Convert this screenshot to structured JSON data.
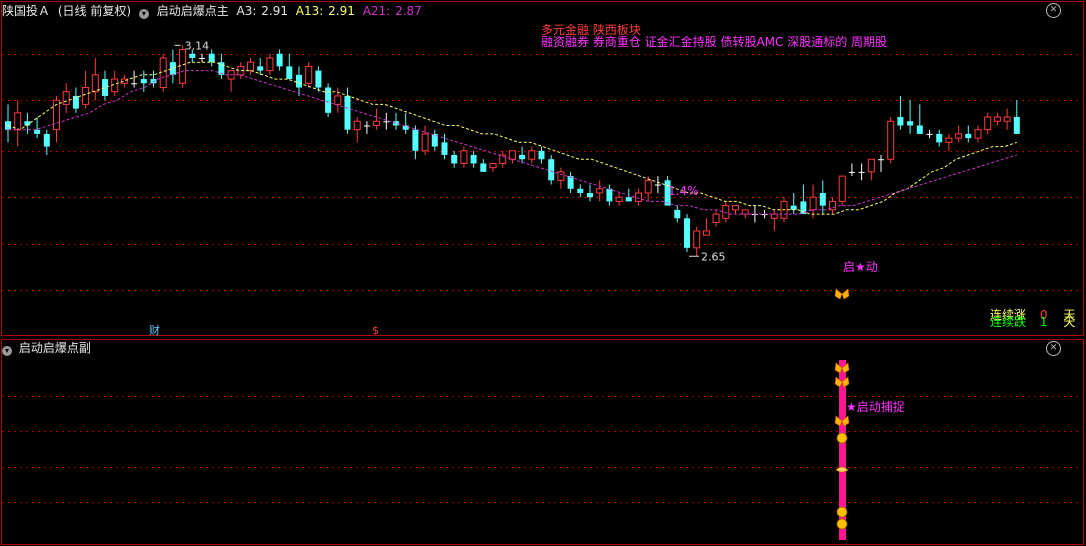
{
  "header": {
    "symbol": "陕国投Ａ",
    "period": "(日线 前复权)",
    "main_indicator": "启动启爆点主",
    "a3_label": "A3:",
    "a3_value": "2.91",
    "a13_label": "A13:",
    "a13_value": "2.91",
    "a21_label": "A21:",
    "a21_value": "2.87"
  },
  "sub_panel": {
    "indicator": "启动启爆点副",
    "annotation": "★启动捕捉"
  },
  "concept_text": {
    "line1": "多元金融 陕西板块",
    "line2": "融资融券 券商重仓 证金汇金持股 债转股AMC 深股通标的 周期股"
  },
  "annotations": {
    "high_label": "3.14",
    "low_label": "2.65",
    "pct_label": "1.4%",
    "start_label": "启★动",
    "finance_marker": "财",
    "dollar_marker": "$"
  },
  "legend": {
    "up_label": "连续涨",
    "up_count": "0",
    "up_unit": "天",
    "down_label": "连续跌",
    "down_count": "1",
    "down_unit": "天"
  },
  "colors": {
    "up": "#ff3b3b",
    "down": "#54ffff",
    "doji": "#ffffff",
    "ma_short": "#ffff66",
    "ma_long": "#cc33cc",
    "magenta": "#ff33ff",
    "axis_red": "#b00000",
    "pink_bar": "#ff1493",
    "butterfly": "#ffb000"
  },
  "icons": [
    "close-icon",
    "collapse-icon",
    "butterfly-icon",
    "coin-icon",
    "pink-bar"
  ],
  "chart_data": {
    "type": "candlestick",
    "ylim": [
      2.58,
      3.22
    ],
    "ytick_values": [
      3.14,
      3.03,
      2.91,
      2.8,
      2.69,
      2.58
    ],
    "ohlc": [
      [
        2.98,
        3.02,
        2.93,
        2.96
      ],
      [
        2.96,
        3.03,
        2.92,
        3.0
      ],
      [
        2.98,
        3.0,
        2.95,
        2.97
      ],
      [
        2.96,
        2.99,
        2.94,
        2.95
      ],
      [
        2.95,
        2.96,
        2.9,
        2.92
      ],
      [
        2.96,
        3.04,
        2.93,
        3.03
      ],
      [
        3.02,
        3.07,
        3.0,
        3.05
      ],
      [
        3.04,
        3.06,
        3.0,
        3.01
      ],
      [
        3.02,
        3.1,
        3.01,
        3.06
      ],
      [
        3.05,
        3.13,
        3.03,
        3.09
      ],
      [
        3.08,
        3.1,
        3.03,
        3.04
      ],
      [
        3.05,
        3.1,
        3.04,
        3.08
      ],
      [
        3.07,
        3.09,
        3.06,
        3.08
      ],
      [
        3.07,
        3.1,
        3.06,
        3.07
      ],
      [
        3.08,
        3.1,
        3.05,
        3.07
      ],
      [
        3.08,
        3.1,
        3.06,
        3.07
      ],
      [
        3.06,
        3.14,
        3.05,
        3.13
      ],
      [
        3.12,
        3.15,
        3.07,
        3.09
      ],
      [
        3.07,
        3.16,
        3.06,
        3.15
      ],
      [
        3.14,
        3.15,
        3.12,
        3.13
      ],
      [
        3.13,
        3.14,
        3.12,
        3.13
      ],
      [
        3.14,
        3.15,
        3.11,
        3.12
      ],
      [
        3.12,
        3.14,
        3.08,
        3.09
      ],
      [
        3.08,
        3.1,
        3.05,
        3.1
      ],
      [
        3.09,
        3.12,
        3.08,
        3.11
      ],
      [
        3.1,
        3.13,
        3.09,
        3.12
      ],
      [
        3.11,
        3.13,
        3.09,
        3.1
      ],
      [
        3.1,
        3.14,
        3.09,
        3.13
      ],
      [
        3.14,
        3.15,
        3.1,
        3.11
      ],
      [
        3.11,
        3.14,
        3.08,
        3.08
      ],
      [
        3.09,
        3.11,
        3.04,
        3.06
      ],
      [
        3.07,
        3.12,
        3.06,
        3.11
      ],
      [
        3.1,
        3.11,
        3.05,
        3.06
      ],
      [
        3.06,
        3.07,
        2.99,
        3.0
      ],
      [
        3.02,
        3.06,
        3.0,
        3.04
      ],
      [
        3.04,
        3.06,
        2.95,
        2.96
      ],
      [
        2.96,
        2.99,
        2.93,
        2.98
      ],
      [
        2.97,
        2.98,
        2.95,
        2.97
      ],
      [
        2.97,
        3.01,
        2.96,
        2.98
      ],
      [
        2.98,
        3.0,
        2.96,
        2.98
      ],
      [
        2.98,
        3.0,
        2.96,
        2.97
      ],
      [
        2.97,
        3.0,
        2.95,
        2.96
      ],
      [
        2.96,
        2.97,
        2.89,
        2.91
      ],
      [
        2.91,
        2.97,
        2.9,
        2.95
      ],
      [
        2.95,
        2.96,
        2.91,
        2.92
      ],
      [
        2.93,
        2.95,
        2.89,
        2.9
      ],
      [
        2.9,
        2.91,
        2.87,
        2.88
      ],
      [
        2.88,
        2.92,
        2.87,
        2.91
      ],
      [
        2.9,
        2.91,
        2.87,
        2.88
      ],
      [
        2.88,
        2.89,
        2.86,
        2.86
      ],
      [
        2.87,
        2.88,
        2.86,
        2.88
      ],
      [
        2.88,
        2.91,
        2.87,
        2.9
      ],
      [
        2.89,
        2.91,
        2.88,
        2.91
      ],
      [
        2.9,
        2.92,
        2.88,
        2.89
      ],
      [
        2.89,
        2.92,
        2.88,
        2.91
      ],
      [
        2.91,
        2.92,
        2.88,
        2.89
      ],
      [
        2.89,
        2.9,
        2.83,
        2.84
      ],
      [
        2.84,
        2.87,
        2.82,
        2.86
      ],
      [
        2.85,
        2.86,
        2.81,
        2.82
      ],
      [
        2.82,
        2.83,
        2.8,
        2.81
      ],
      [
        2.81,
        2.83,
        2.79,
        2.8
      ],
      [
        2.81,
        2.84,
        2.79,
        2.82
      ],
      [
        2.82,
        2.83,
        2.78,
        2.79
      ],
      [
        2.79,
        2.81,
        2.78,
        2.8
      ],
      [
        2.8,
        2.82,
        2.79,
        2.79
      ],
      [
        2.79,
        2.82,
        2.78,
        2.81
      ],
      [
        2.81,
        2.85,
        2.79,
        2.84
      ],
      [
        2.83,
        2.85,
        2.81,
        2.83
      ],
      [
        2.84,
        2.85,
        2.79,
        2.78
      ],
      [
        2.77,
        2.78,
        2.74,
        2.75
      ],
      [
        2.75,
        2.76,
        2.67,
        2.68
      ],
      [
        2.68,
        2.73,
        2.66,
        2.72
      ],
      [
        2.71,
        2.75,
        2.71,
        2.72
      ],
      [
        2.74,
        2.77,
        2.73,
        2.76
      ],
      [
        2.75,
        2.79,
        2.74,
        2.78
      ],
      [
        2.77,
        2.78,
        2.76,
        2.78
      ],
      [
        2.76,
        2.77,
        2.75,
        2.77
      ],
      [
        2.76,
        2.78,
        2.74,
        2.76
      ],
      [
        2.76,
        2.77,
        2.75,
        2.76
      ],
      [
        2.75,
        2.77,
        2.72,
        2.76
      ],
      [
        2.75,
        2.8,
        2.74,
        2.79
      ],
      [
        2.78,
        2.81,
        2.76,
        2.77
      ],
      [
        2.79,
        2.83,
        2.77,
        2.76
      ],
      [
        2.77,
        2.83,
        2.75,
        2.8
      ],
      [
        2.81,
        2.84,
        2.76,
        2.78
      ],
      [
        2.77,
        2.8,
        2.76,
        2.79
      ],
      [
        2.79,
        2.85,
        2.78,
        2.85
      ],
      [
        2.86,
        2.88,
        2.85,
        2.86
      ],
      [
        2.86,
        2.88,
        2.84,
        2.86
      ],
      [
        2.86,
        2.89,
        2.84,
        2.89
      ],
      [
        2.89,
        2.9,
        2.86,
        2.89
      ],
      [
        2.89,
        2.99,
        2.88,
        2.98
      ],
      [
        2.99,
        3.04,
        2.96,
        2.97
      ],
      [
        2.98,
        3.03,
        2.95,
        2.97
      ],
      [
        2.97,
        3.02,
        2.95,
        2.95
      ],
      [
        2.95,
        2.96,
        2.94,
        2.95
      ],
      [
        2.95,
        2.96,
        2.92,
        2.93
      ],
      [
        2.93,
        2.95,
        2.91,
        2.94
      ],
      [
        2.94,
        2.97,
        2.93,
        2.95
      ],
      [
        2.95,
        2.97,
        2.93,
        2.94
      ],
      [
        2.94,
        2.97,
        2.93,
        2.96
      ],
      [
        2.96,
        3.0,
        2.95,
        2.99
      ],
      [
        2.98,
        3.0,
        2.97,
        2.99
      ],
      [
        2.98,
        3.01,
        2.96,
        2.99
      ],
      [
        2.99,
        3.03,
        2.95,
        2.95
      ]
    ],
    "ma_short": [
      2.97,
      2.96,
      2.98,
      3.0,
      3.02,
      3.03,
      3.04,
      3.05,
      3.06,
      3.07,
      3.08,
      3.09,
      3.09,
      3.1,
      3.11,
      3.12,
      3.12,
      3.12,
      3.11,
      3.1,
      3.1,
      3.09,
      3.08,
      3.08,
      3.07,
      3.06,
      3.05,
      3.05,
      3.04,
      3.03,
      3.02,
      3.02,
      3.01,
      3.0,
      2.99,
      2.98,
      2.97,
      2.97,
      2.96,
      2.95,
      2.95,
      2.94,
      2.93,
      2.93,
      2.92,
      2.91,
      2.9,
      2.89,
      2.89,
      2.88,
      2.87,
      2.86,
      2.85,
      2.84,
      2.83,
      2.82,
      2.81,
      2.81,
      2.8,
      2.79,
      2.79,
      2.78,
      2.78,
      2.77,
      2.77,
      2.77,
      2.76,
      2.76,
      2.76,
      2.77,
      2.77,
      2.78,
      2.79,
      2.81,
      2.82,
      2.84,
      2.86,
      2.87,
      2.89,
      2.9,
      2.91,
      2.92,
      2.92,
      2.93
    ],
    "ma_long": [
      2.96,
      2.96,
      2.96,
      2.97,
      2.98,
      2.99,
      3.0,
      3.02,
      3.03,
      3.05,
      3.06,
      3.08,
      3.09,
      3.1,
      3.1,
      3.1,
      3.09,
      3.09,
      3.08,
      3.07,
      3.06,
      3.05,
      3.04,
      3.03,
      3.02,
      3.01,
      3.0,
      2.99,
      2.98,
      2.97,
      2.96,
      2.95,
      2.94,
      2.93,
      2.92,
      2.91,
      2.9,
      2.89,
      2.88,
      2.87,
      2.86,
      2.85,
      2.84,
      2.83,
      2.82,
      2.81,
      2.8,
      2.79,
      2.79,
      2.78,
      2.78,
      2.77,
      2.77,
      2.76,
      2.76,
      2.76,
      2.76,
      2.76,
      2.76,
      2.77,
      2.77,
      2.78,
      2.78,
      2.79,
      2.8,
      2.81,
      2.82,
      2.83,
      2.84,
      2.85,
      2.86,
      2.87,
      2.88,
      2.89,
      2.9
    ]
  }
}
